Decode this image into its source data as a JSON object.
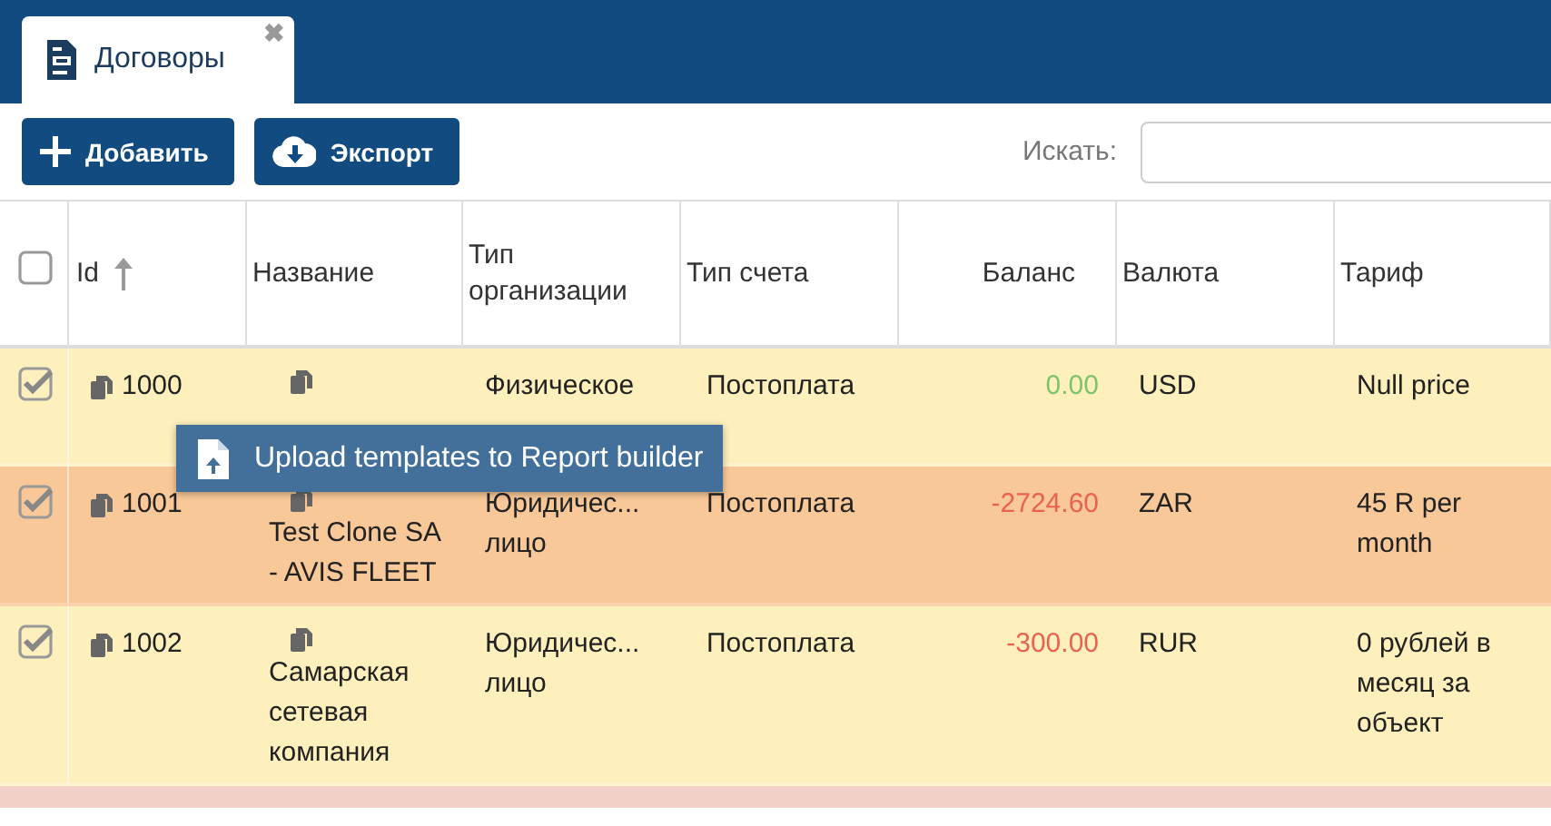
{
  "tabs": [
    {
      "label": "Договоры",
      "selected": true,
      "close": "✖"
    }
  ],
  "toolbar": {
    "buttons": [
      {
        "label": "Добавить",
        "kind": "add"
      },
      {
        "label": "Экспорт",
        "kind": "export"
      }
    ],
    "search": {
      "label": "Искать:"
    }
  },
  "table": {
    "all_checked": false,
    "columns": [
      {
        "label": "Id",
        "kind": "text",
        "sorted": true
      },
      {
        "label": "Название",
        "kind": "text"
      },
      {
        "label": "Тип организации",
        "kind": "text"
      },
      {
        "label": "Тип счета",
        "kind": "text"
      },
      {
        "label": "Баланс",
        "kind": "number"
      },
      {
        "label": "Валюта",
        "kind": "text"
      },
      {
        "label": "Тариф",
        "kind": "text"
      }
    ],
    "rows": [
      {
        "color": "#fef0bd",
        "selected": true,
        "id": "1000",
        "org_type": "Физическое",
        "account_type": "Постоплата",
        "balance": "0.00",
        "negative": false,
        "currency": "USD",
        "tariff": "Null price"
      },
      {
        "color": "#f9c898",
        "selected": true,
        "id": "1001",
        "name": "Test Clone SA - AVIS FLEET",
        "org_type": "Юридичес... лицо",
        "account_type": "Постоплата",
        "balance": "-2724.60",
        "negative": true,
        "currency": "ZAR",
        "tariff": "45 R per month"
      },
      {
        "color": "#fef0bd",
        "selected": true,
        "id": "1002",
        "name": "Самарская сетевая компания",
        "org_type": "Юридичес... лицо",
        "account_type": "Постоплата",
        "balance": "-300.00",
        "negative": true,
        "currency": "RUR",
        "tariff": "0 рублей в месяц за объект"
      },
      {
        "color": "#f3d1c9"
      }
    ]
  },
  "tooltip": {
    "label": "Upload templates to Report builder"
  }
}
